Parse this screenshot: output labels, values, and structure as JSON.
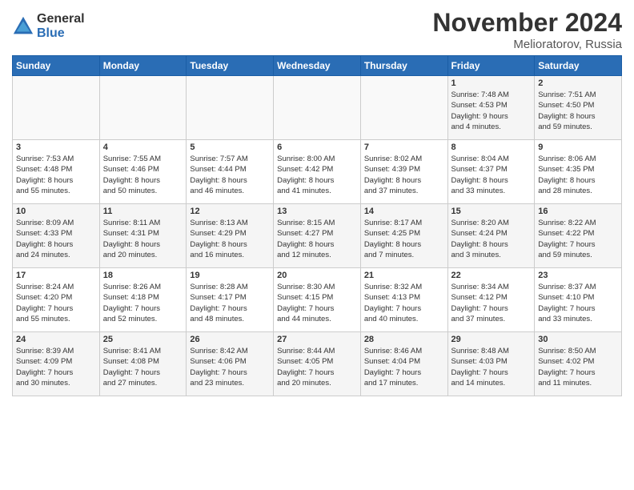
{
  "logo": {
    "general": "General",
    "blue": "Blue"
  },
  "title": "November 2024",
  "location": "Melioratorov, Russia",
  "days_of_week": [
    "Sunday",
    "Monday",
    "Tuesday",
    "Wednesday",
    "Thursday",
    "Friday",
    "Saturday"
  ],
  "weeks": [
    [
      {
        "day": "",
        "info": ""
      },
      {
        "day": "",
        "info": ""
      },
      {
        "day": "",
        "info": ""
      },
      {
        "day": "",
        "info": ""
      },
      {
        "day": "",
        "info": ""
      },
      {
        "day": "1",
        "info": "Sunrise: 7:48 AM\nSunset: 4:53 PM\nDaylight: 9 hours\nand 4 minutes."
      },
      {
        "day": "2",
        "info": "Sunrise: 7:51 AM\nSunset: 4:50 PM\nDaylight: 8 hours\nand 59 minutes."
      }
    ],
    [
      {
        "day": "3",
        "info": "Sunrise: 7:53 AM\nSunset: 4:48 PM\nDaylight: 8 hours\nand 55 minutes."
      },
      {
        "day": "4",
        "info": "Sunrise: 7:55 AM\nSunset: 4:46 PM\nDaylight: 8 hours\nand 50 minutes."
      },
      {
        "day": "5",
        "info": "Sunrise: 7:57 AM\nSunset: 4:44 PM\nDaylight: 8 hours\nand 46 minutes."
      },
      {
        "day": "6",
        "info": "Sunrise: 8:00 AM\nSunset: 4:42 PM\nDaylight: 8 hours\nand 41 minutes."
      },
      {
        "day": "7",
        "info": "Sunrise: 8:02 AM\nSunset: 4:39 PM\nDaylight: 8 hours\nand 37 minutes."
      },
      {
        "day": "8",
        "info": "Sunrise: 8:04 AM\nSunset: 4:37 PM\nDaylight: 8 hours\nand 33 minutes."
      },
      {
        "day": "9",
        "info": "Sunrise: 8:06 AM\nSunset: 4:35 PM\nDaylight: 8 hours\nand 28 minutes."
      }
    ],
    [
      {
        "day": "10",
        "info": "Sunrise: 8:09 AM\nSunset: 4:33 PM\nDaylight: 8 hours\nand 24 minutes."
      },
      {
        "day": "11",
        "info": "Sunrise: 8:11 AM\nSunset: 4:31 PM\nDaylight: 8 hours\nand 20 minutes."
      },
      {
        "day": "12",
        "info": "Sunrise: 8:13 AM\nSunset: 4:29 PM\nDaylight: 8 hours\nand 16 minutes."
      },
      {
        "day": "13",
        "info": "Sunrise: 8:15 AM\nSunset: 4:27 PM\nDaylight: 8 hours\nand 12 minutes."
      },
      {
        "day": "14",
        "info": "Sunrise: 8:17 AM\nSunset: 4:25 PM\nDaylight: 8 hours\nand 7 minutes."
      },
      {
        "day": "15",
        "info": "Sunrise: 8:20 AM\nSunset: 4:24 PM\nDaylight: 8 hours\nand 3 minutes."
      },
      {
        "day": "16",
        "info": "Sunrise: 8:22 AM\nSunset: 4:22 PM\nDaylight: 7 hours\nand 59 minutes."
      }
    ],
    [
      {
        "day": "17",
        "info": "Sunrise: 8:24 AM\nSunset: 4:20 PM\nDaylight: 7 hours\nand 55 minutes."
      },
      {
        "day": "18",
        "info": "Sunrise: 8:26 AM\nSunset: 4:18 PM\nDaylight: 7 hours\nand 52 minutes."
      },
      {
        "day": "19",
        "info": "Sunrise: 8:28 AM\nSunset: 4:17 PM\nDaylight: 7 hours\nand 48 minutes."
      },
      {
        "day": "20",
        "info": "Sunrise: 8:30 AM\nSunset: 4:15 PM\nDaylight: 7 hours\nand 44 minutes."
      },
      {
        "day": "21",
        "info": "Sunrise: 8:32 AM\nSunset: 4:13 PM\nDaylight: 7 hours\nand 40 minutes."
      },
      {
        "day": "22",
        "info": "Sunrise: 8:34 AM\nSunset: 4:12 PM\nDaylight: 7 hours\nand 37 minutes."
      },
      {
        "day": "23",
        "info": "Sunrise: 8:37 AM\nSunset: 4:10 PM\nDaylight: 7 hours\nand 33 minutes."
      }
    ],
    [
      {
        "day": "24",
        "info": "Sunrise: 8:39 AM\nSunset: 4:09 PM\nDaylight: 7 hours\nand 30 minutes."
      },
      {
        "day": "25",
        "info": "Sunrise: 8:41 AM\nSunset: 4:08 PM\nDaylight: 7 hours\nand 27 minutes."
      },
      {
        "day": "26",
        "info": "Sunrise: 8:42 AM\nSunset: 4:06 PM\nDaylight: 7 hours\nand 23 minutes."
      },
      {
        "day": "27",
        "info": "Sunrise: 8:44 AM\nSunset: 4:05 PM\nDaylight: 7 hours\nand 20 minutes."
      },
      {
        "day": "28",
        "info": "Sunrise: 8:46 AM\nSunset: 4:04 PM\nDaylight: 7 hours\nand 17 minutes."
      },
      {
        "day": "29",
        "info": "Sunrise: 8:48 AM\nSunset: 4:03 PM\nDaylight: 7 hours\nand 14 minutes."
      },
      {
        "day": "30",
        "info": "Sunrise: 8:50 AM\nSunset: 4:02 PM\nDaylight: 7 hours\nand 11 minutes."
      }
    ]
  ]
}
